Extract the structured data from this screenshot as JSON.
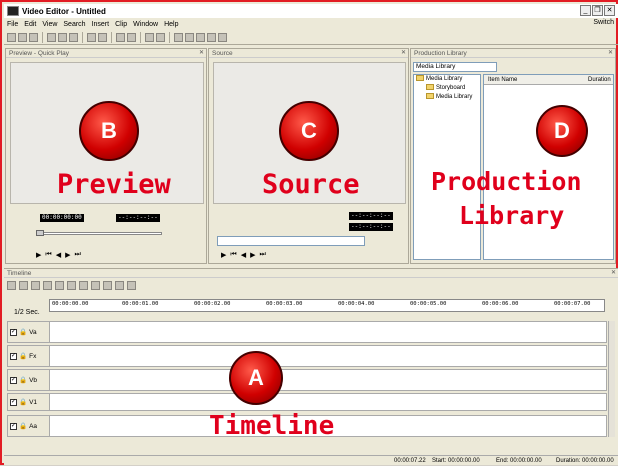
{
  "window": {
    "title": "Video Editor - Untitled",
    "switch_label": "Switch"
  },
  "menu": [
    "File",
    "Edit",
    "View",
    "Search",
    "Insert",
    "Clip",
    "Window",
    "Help"
  ],
  "panels": {
    "preview": {
      "title": "Preview - Quick Play",
      "badge": "B",
      "label": "Preview",
      "timecode": "00:00:00:00",
      "timecode2": "--:--:--:--"
    },
    "source": {
      "title": "Source",
      "badge": "C",
      "label": "Source",
      "timecode": "--:--:--:--",
      "timecode2": "--:--:--:--"
    },
    "library": {
      "title": "Production Library",
      "dropdown": "Media Library",
      "badge": "D",
      "label_line1": "Production",
      "label_line2": "Library",
      "tree": [
        "Media Library",
        "Storyboard",
        "Media Library"
      ],
      "columns": [
        "Item Name",
        "Duration"
      ]
    }
  },
  "timeline": {
    "title": "Timeline",
    "scale": "1/2 Sec.",
    "badge": "A",
    "label": "Timeline",
    "ruler": [
      "00:00:00.00",
      "00:00:01.00",
      "00:00:02.00",
      "00:00:03.00",
      "00:00:04.00",
      "00:00:05.00",
      "00:00:06.00",
      "00:00:07.00"
    ],
    "tracks": [
      "Va",
      "Fx",
      "Vb",
      "V1",
      "Aa"
    ]
  },
  "status": {
    "duration": "00:00:07.22",
    "start": "Start: 00:00:00.00",
    "end": "End: 00:00:00.00",
    "dur": "Duration: 00:00:00.00"
  }
}
